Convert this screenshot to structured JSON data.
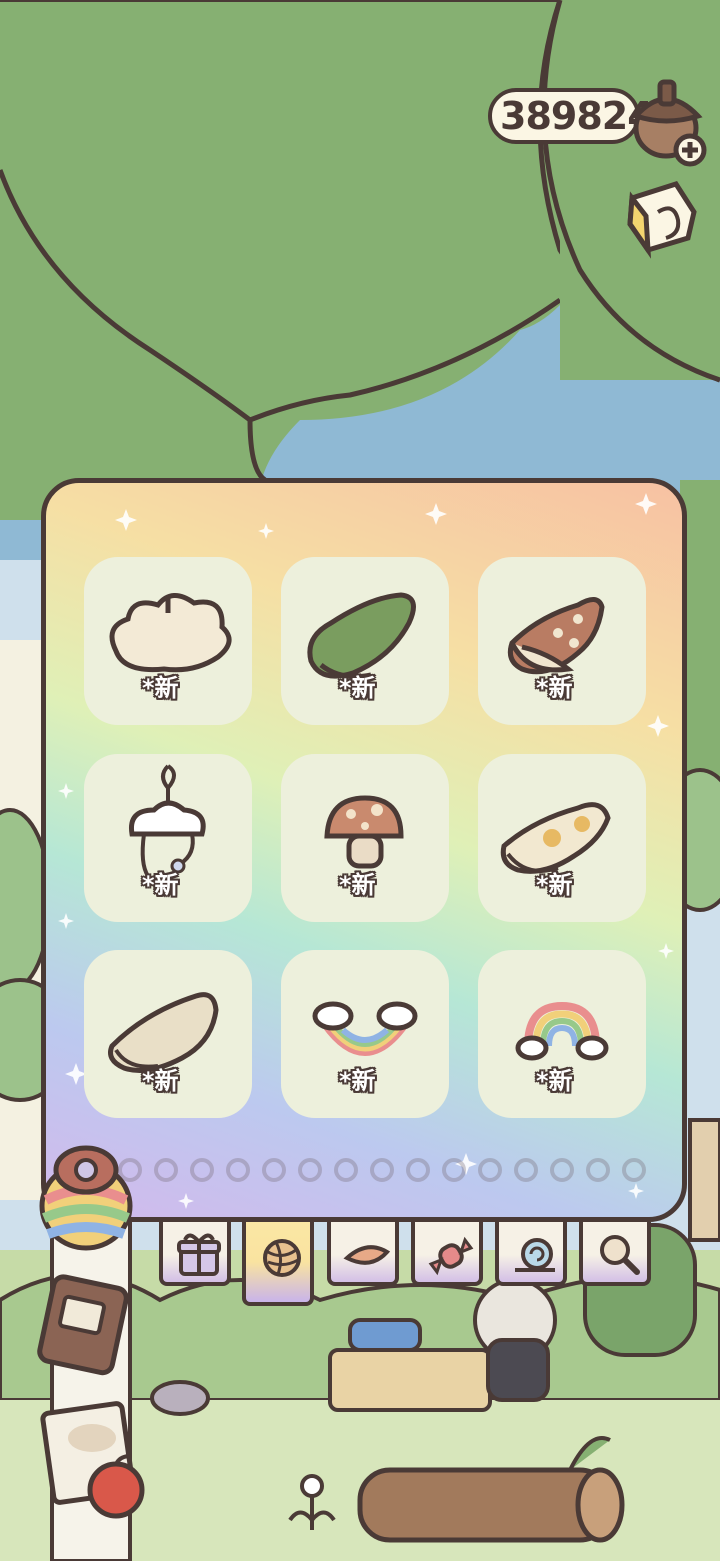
{
  "hud": {
    "currency_amount": "389824",
    "currency_icon": "acorn-icon",
    "add_icon": "plus-icon",
    "guide_icon": "guide-book-icon"
  },
  "collection": {
    "items": [
      {
        "icon": "cloud-hat-icon",
        "tag": "*新"
      },
      {
        "icon": "green-leaf-bag-icon",
        "tag": "*新"
      },
      {
        "icon": "polka-dot-scarf-icon",
        "tag": "*新"
      },
      {
        "icon": "cloud-raindrop-charm-icon",
        "tag": "*新"
      },
      {
        "icon": "mushroom-icon",
        "tag": "*新"
      },
      {
        "icon": "yellow-print-scarf-icon",
        "tag": "*新"
      },
      {
        "icon": "beige-wrap-icon",
        "tag": "*新"
      },
      {
        "icon": "rainbow-glasses-icon",
        "tag": "*新"
      },
      {
        "icon": "rainbow-cloud-icon",
        "tag": "*新"
      }
    ],
    "page_count": 15
  },
  "tabs": [
    {
      "icon": "gift-icon",
      "active": false
    },
    {
      "icon": "yarn-ball-icon",
      "active": true
    },
    {
      "icon": "leaf-icon",
      "active": false
    },
    {
      "icon": "candy-icon",
      "active": false
    },
    {
      "icon": "snail-icon",
      "active": false
    },
    {
      "icon": "magnifier-icon",
      "active": false
    }
  ],
  "colors": {
    "outline": "#4a3a36",
    "tree_green": "#86b072",
    "slot_bg": "#edf0dc"
  }
}
